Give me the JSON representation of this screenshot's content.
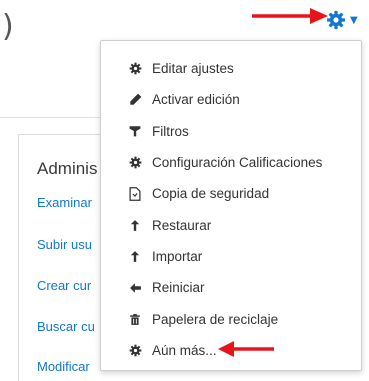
{
  "page": {
    "heading_fragment": ")"
  },
  "cog": {
    "icon": "gear-icon",
    "caret_icon": "caret-down-icon",
    "color": "#1177d1"
  },
  "annotation": {
    "arrow_color": "#e8141c"
  },
  "admin_block": {
    "title": "Adminis",
    "links": [
      "Examinar",
      "Subir usu",
      "Crear cur",
      "Buscar cu",
      "Modificar"
    ],
    "link_color": "#1177d1"
  },
  "menu": {
    "items": [
      {
        "label": "Editar ajustes",
        "icon": "gear-icon"
      },
      {
        "label": "Activar edición",
        "icon": "pencil-icon"
      },
      {
        "label": "Filtros",
        "icon": "filter-icon"
      },
      {
        "label": "Configuración Calificaciones",
        "icon": "gear-icon"
      },
      {
        "label": "Copia de seguridad",
        "icon": "file-icon"
      },
      {
        "label": "Restaurar",
        "icon": "upload-icon"
      },
      {
        "label": "Importar",
        "icon": "upload-icon"
      },
      {
        "label": "Reiniciar",
        "icon": "arrow-left-icon"
      },
      {
        "label": "Papelera de reciclaje",
        "icon": "trash-icon"
      },
      {
        "label": "Aún más...",
        "icon": "gear-icon"
      }
    ]
  }
}
